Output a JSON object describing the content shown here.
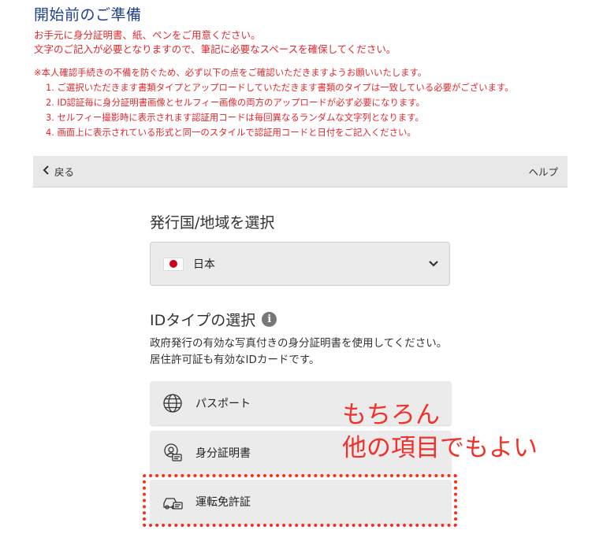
{
  "page": {
    "heading": "開始前のご準備",
    "intro": [
      "お手元に身分証明書、紙、ペンをご用意ください。",
      "文字のご記入が必要となりますので、筆記に必要なスペースを確保してください。"
    ],
    "notice_title": "※本人確認手続きの不備を防ぐため、必ず以下の点をご確認いただきますようお願いいたします。",
    "notices": [
      "1. ご選択いただきます書類タイプとアップロードしていただきます書類のタイプは一致している必要がございます。",
      "2. ID認証毎に身分証明書画像とセルフィー画像の両方のアップロードが必ず必要になります。",
      "3. セルフィー撮影時に表示されます認証用コードは毎回異なるランダムな文字列となります。",
      "4. 画面上に表示されている形式と同一のスタイルで認証用コードと日付をご記入ください。"
    ]
  },
  "nav": {
    "back_label": "戻る",
    "help_label": "ヘルプ"
  },
  "country": {
    "section_title": "発行国/地域を選択",
    "selected": "日本"
  },
  "id_type": {
    "section_title": "IDタイプの選択",
    "description": "政府発行の有効な写真付きの身分証明書を使用してください。 居住許可証も有効なIDカードです。",
    "options": [
      {
        "label": "パスポート",
        "icon": "globe-icon"
      },
      {
        "label": "身分証明書",
        "icon": "id-card-icon"
      },
      {
        "label": "運転免許証",
        "icon": "car-license-icon"
      }
    ]
  },
  "annotation": {
    "line1": "もちろん",
    "line2": "他の項目でもよい"
  },
  "colors": {
    "heading": "#1f3f8f",
    "notice": "#e0282e",
    "highlight": "#ff2a1a",
    "flag_red": "#d0021b"
  }
}
